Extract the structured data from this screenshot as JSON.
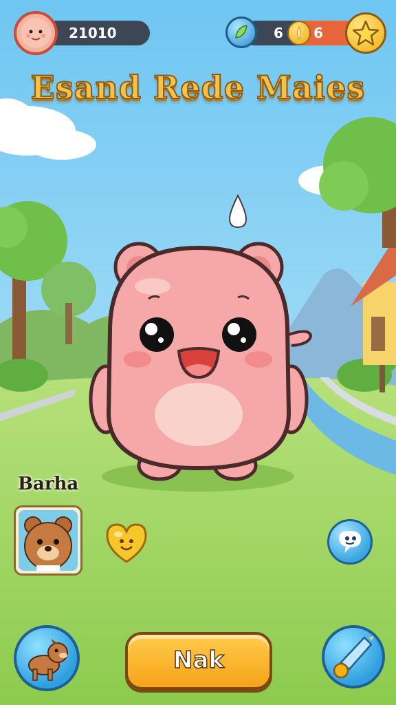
{
  "hud": {
    "player_score": "21010",
    "energy_value": "6",
    "coin_value": "6"
  },
  "title": "Esand Rede Maies",
  "pet": {
    "name": "Barha"
  },
  "actions": {
    "main_button_label": "Nak"
  },
  "icons": {
    "avatar": "pig-face-avatar-icon",
    "energy": "leaf-gem-icon",
    "coin": "gold-coin-icon",
    "star": "star-icon",
    "friend": "bear-friend-icon",
    "heart": "smiley-heart-icon",
    "chat": "chat-bubble-icon",
    "dog": "dog-icon",
    "shop": "crystal-icon"
  },
  "colors": {
    "sky": "#8fd3f4",
    "grass": "#9ed35c",
    "pet": "#f6a8a8",
    "button": "#f7a21a",
    "hud_dark": "#3d4654"
  }
}
